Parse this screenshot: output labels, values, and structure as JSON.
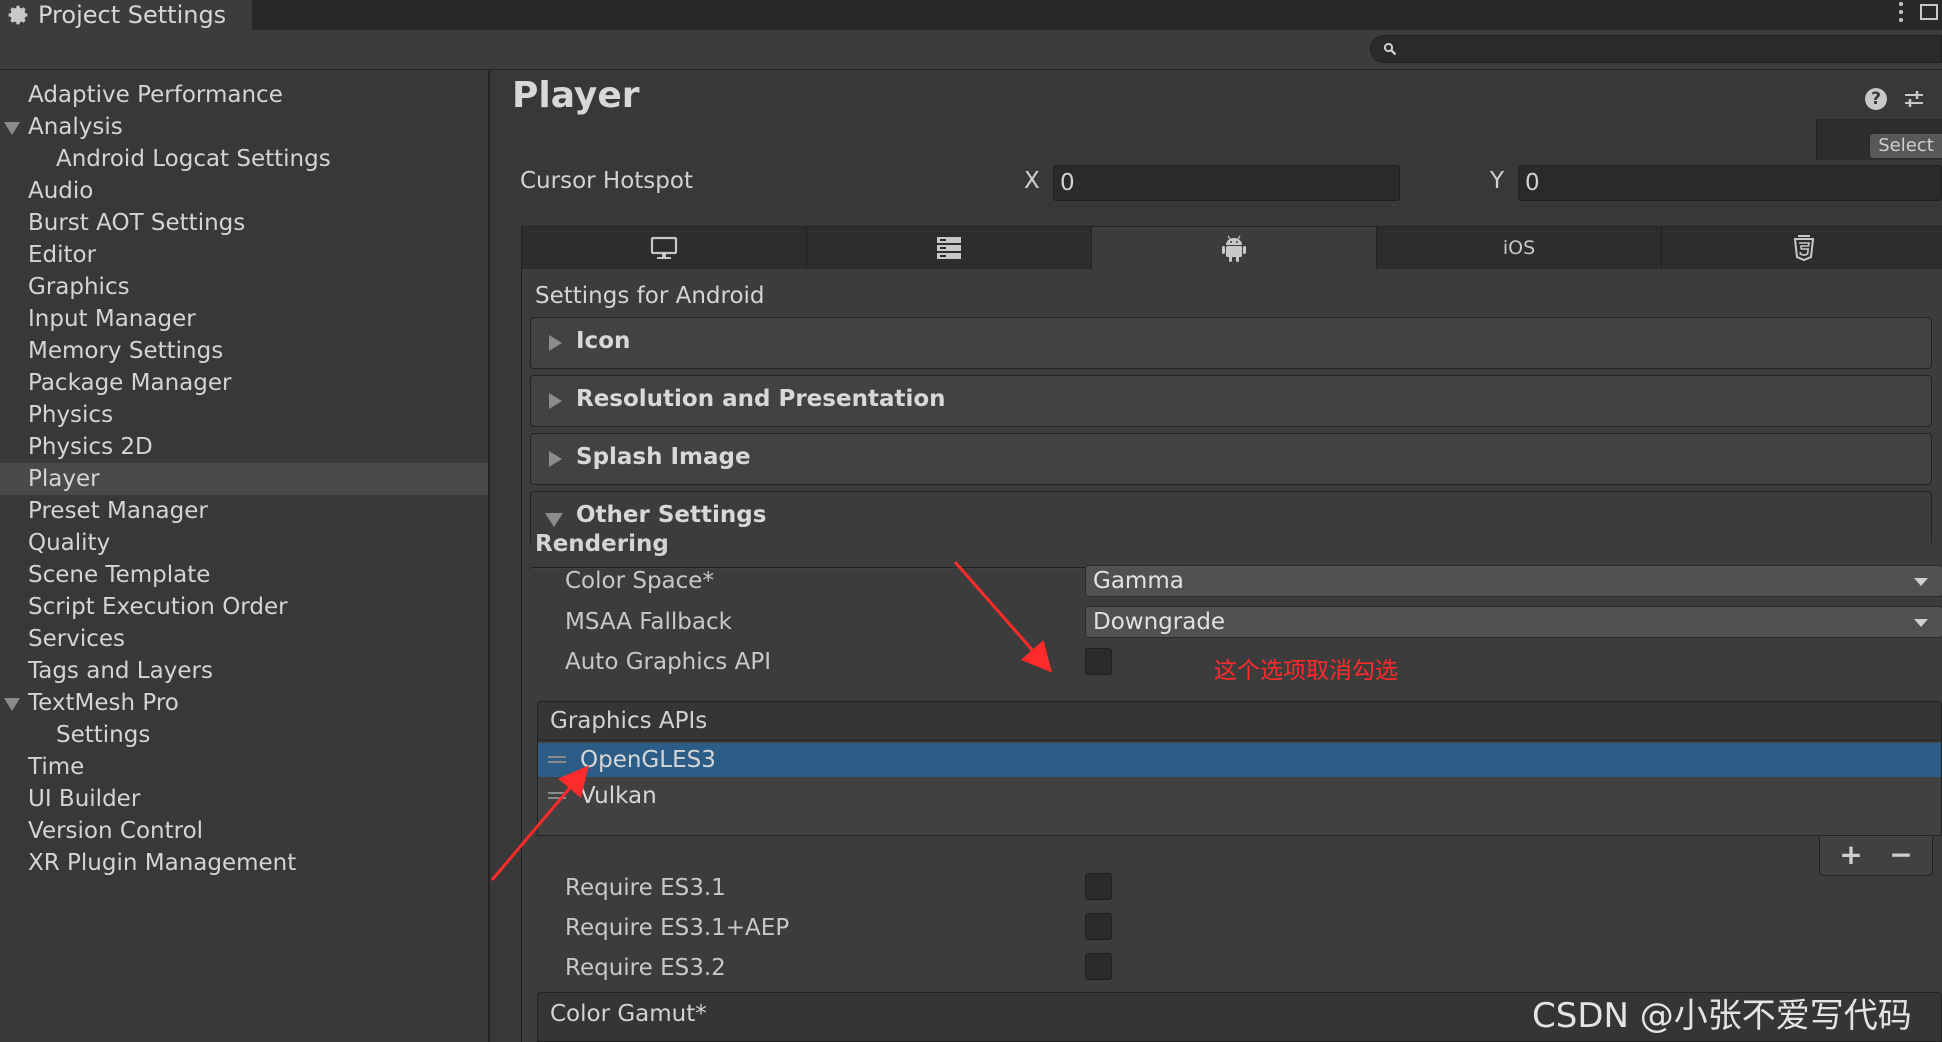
{
  "window": {
    "title": "Project Settings",
    "icon": "gear-icon",
    "menu_icon": "kebab-menu-icon",
    "maximize_icon": "maximize-icon"
  },
  "search": {
    "icon": "search-icon",
    "value": ""
  },
  "sidebar": {
    "items": [
      {
        "label": "Adaptive Performance",
        "indent": 0,
        "expanded": null,
        "selected": false
      },
      {
        "label": "Analysis",
        "indent": 0,
        "expanded": true,
        "selected": false
      },
      {
        "label": "Android Logcat Settings",
        "indent": 1,
        "expanded": null,
        "selected": false
      },
      {
        "label": "Audio",
        "indent": 0,
        "expanded": null,
        "selected": false
      },
      {
        "label": "Burst AOT Settings",
        "indent": 0,
        "expanded": null,
        "selected": false
      },
      {
        "label": "Editor",
        "indent": 0,
        "expanded": null,
        "selected": false
      },
      {
        "label": "Graphics",
        "indent": 0,
        "expanded": null,
        "selected": false
      },
      {
        "label": "Input Manager",
        "indent": 0,
        "expanded": null,
        "selected": false
      },
      {
        "label": "Memory Settings",
        "indent": 0,
        "expanded": null,
        "selected": false
      },
      {
        "label": "Package Manager",
        "indent": 0,
        "expanded": null,
        "selected": false
      },
      {
        "label": "Physics",
        "indent": 0,
        "expanded": null,
        "selected": false
      },
      {
        "label": "Physics 2D",
        "indent": 0,
        "expanded": null,
        "selected": false
      },
      {
        "label": "Player",
        "indent": 0,
        "expanded": null,
        "selected": true
      },
      {
        "label": "Preset Manager",
        "indent": 0,
        "expanded": null,
        "selected": false
      },
      {
        "label": "Quality",
        "indent": 0,
        "expanded": null,
        "selected": false
      },
      {
        "label": "Scene Template",
        "indent": 0,
        "expanded": null,
        "selected": false
      },
      {
        "label": "Script Execution Order",
        "indent": 0,
        "expanded": null,
        "selected": false
      },
      {
        "label": "Services",
        "indent": 0,
        "expanded": null,
        "selected": false
      },
      {
        "label": "Tags and Layers",
        "indent": 0,
        "expanded": null,
        "selected": false
      },
      {
        "label": "TextMesh Pro",
        "indent": 0,
        "expanded": true,
        "selected": false
      },
      {
        "label": "Settings",
        "indent": 1,
        "expanded": null,
        "selected": false
      },
      {
        "label": "Time",
        "indent": 0,
        "expanded": null,
        "selected": false
      },
      {
        "label": "UI Builder",
        "indent": 0,
        "expanded": null,
        "selected": false
      },
      {
        "label": "Version Control",
        "indent": 0,
        "expanded": null,
        "selected": false
      },
      {
        "label": "XR Plugin Management",
        "indent": 0,
        "expanded": null,
        "selected": false
      }
    ]
  },
  "main": {
    "title": "Player",
    "help_icon": "help-icon",
    "settings_icon": "sliders-icon",
    "select_label": "Select",
    "cursor_hotspot": {
      "label": "Cursor Hotspot",
      "x_label": "X",
      "x_value": "0",
      "y_label": "Y",
      "y_value": "0"
    },
    "platform_tabs": [
      {
        "icon": "monitor-icon",
        "label": "",
        "active": false
      },
      {
        "icon": "server-icon",
        "label": "",
        "active": false
      },
      {
        "icon": "android-icon",
        "label": "",
        "active": true
      },
      {
        "icon": "",
        "label": "iOS",
        "active": false
      },
      {
        "icon": "html5-icon",
        "label": "",
        "active": false
      }
    ],
    "settings_for": "Settings for Android",
    "foldouts": [
      {
        "label": "Icon",
        "expanded": false
      },
      {
        "label": "Resolution and Presentation",
        "expanded": false
      },
      {
        "label": "Splash Image",
        "expanded": false
      },
      {
        "label": "Other Settings",
        "expanded": true
      }
    ],
    "other_settings": {
      "rendering_header": "Rendering",
      "color_space": {
        "label": "Color Space*",
        "value": "Gamma"
      },
      "msaa_fallback": {
        "label": "MSAA Fallback",
        "value": "Downgrade"
      },
      "auto_graphics_api": {
        "label": "Auto Graphics API",
        "checked": false
      },
      "annotation": "这个选项取消勾选",
      "graphics_apis": {
        "header": "Graphics APIs",
        "items": [
          {
            "name": "OpenGLES3",
            "selected": true
          },
          {
            "name": "Vulkan",
            "selected": false
          }
        ],
        "add_label": "+",
        "remove_label": "−"
      },
      "require_es31": {
        "label": "Require ES3.1",
        "checked": false
      },
      "require_es31_aep": {
        "label": "Require ES3.1+AEP",
        "checked": false
      },
      "require_es32": {
        "label": "Require ES3.2",
        "checked": false
      },
      "color_gamut_header": "Color Gamut*"
    }
  },
  "watermark": "CSDN @小张不爱写代码",
  "colors": {
    "background": "#383838",
    "panel": "#3c3c3c",
    "selection_blue": "#2c5d87",
    "annotation_red": "#ff2a2a"
  }
}
